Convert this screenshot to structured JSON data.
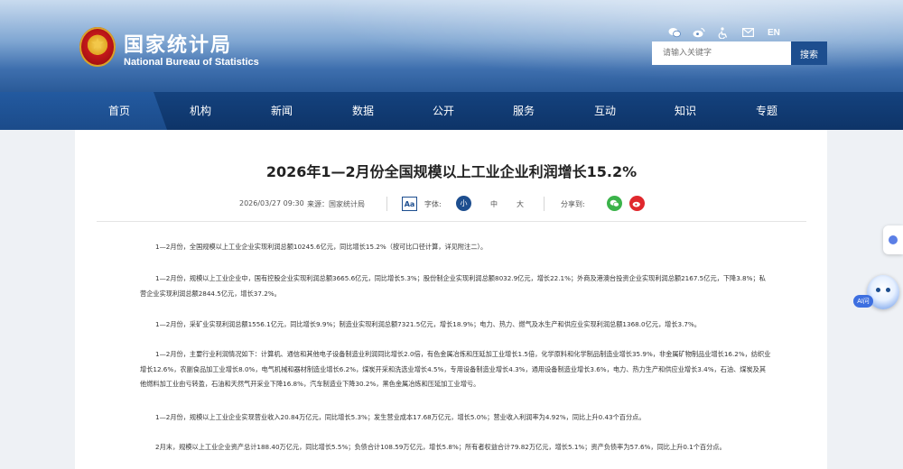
{
  "header": {
    "logo_cn": "国家统计局",
    "logo_en": "National Bureau of Statistics",
    "icons": [
      "wechat-icon",
      "weibo-icon",
      "accessibility-icon",
      "mail-icon"
    ],
    "lang_label": "EN",
    "search_placeholder": "请输入关键字",
    "search_button": "搜索"
  },
  "nav": {
    "items": [
      "首页",
      "机构",
      "新闻",
      "数据",
      "公开",
      "服务",
      "互动",
      "知识",
      "专题"
    ],
    "active": "数据"
  },
  "article": {
    "title": "2026年1—2月份全国规模以上工业企业利润增长15.2%",
    "date": "2026/03/27 09:30",
    "source_label": "来源：国家统计局",
    "aa_label": "Aa",
    "font_label": "字体:",
    "size_small": "小",
    "size_medium": "中",
    "size_large": "大",
    "share_label": "分享到:",
    "paragraphs": [
      "1—2月份，全国规模以上工业企业实现利润总额10245.6亿元，同比增长15.2%（按可比口径计算，详见附注二）。",
      "1—2月份，规模以上工业企业中，国有控股企业实现利润总额3665.6亿元，同比增长5.3%；股份制企业实现利润总额8032.9亿元，增长22.1%；外商及港澳台投资企业实现利润总额2167.5亿元，下降3.8%；私营企业实现利润总额2844.5亿元，增长37.2%。",
      "1—2月份，采矿业实现利润总额1556.1亿元，同比增长9.9%；制造业实现利润总额7321.5亿元，增长18.9%；电力、热力、燃气及水生产和供应业实现利润总额1368.0亿元，增长3.7%。",
      "1—2月份，主要行业利润情况如下：计算机、通信和其他电子设备制造业利润同比增长2.0倍，有色金属冶炼和压延加工业增长1.5倍，化学原料和化学制品制造业增长35.9%，非金属矿物制品业增长16.2%，纺织业增长12.6%，农副食品加工业增长8.0%，电气机械和器材制造业增长6.2%，煤炭开采和洗选业增长4.5%，专用设备制造业增长4.3%，通用设备制造业增长3.6%，电力、热力生产和供应业增长3.4%，石油、煤炭及其他燃料加工业由亏转盈，石油和天然气开采业下降16.8%，汽车制造业下降30.2%，黑色金属冶炼和压延加工业增亏。",
      "1—2月份，规模以上工业企业实现营业收入20.84万亿元，同比增长5.3%；发生营业成本17.68万亿元，增长5.0%；营业收入利润率为4.92%，同比上升0.43个百分点。",
      "2月末，规模以上工业企业资产总计188.40万亿元，同比增长5.5%；负债合计108.59万亿元，增长5.8%；所有者权益合计79.82万亿元，增长5.1%；资产负债率为57.6%，同比上升0.1个百分点。"
    ]
  },
  "widgets": {
    "ai_label": "AI问"
  }
}
